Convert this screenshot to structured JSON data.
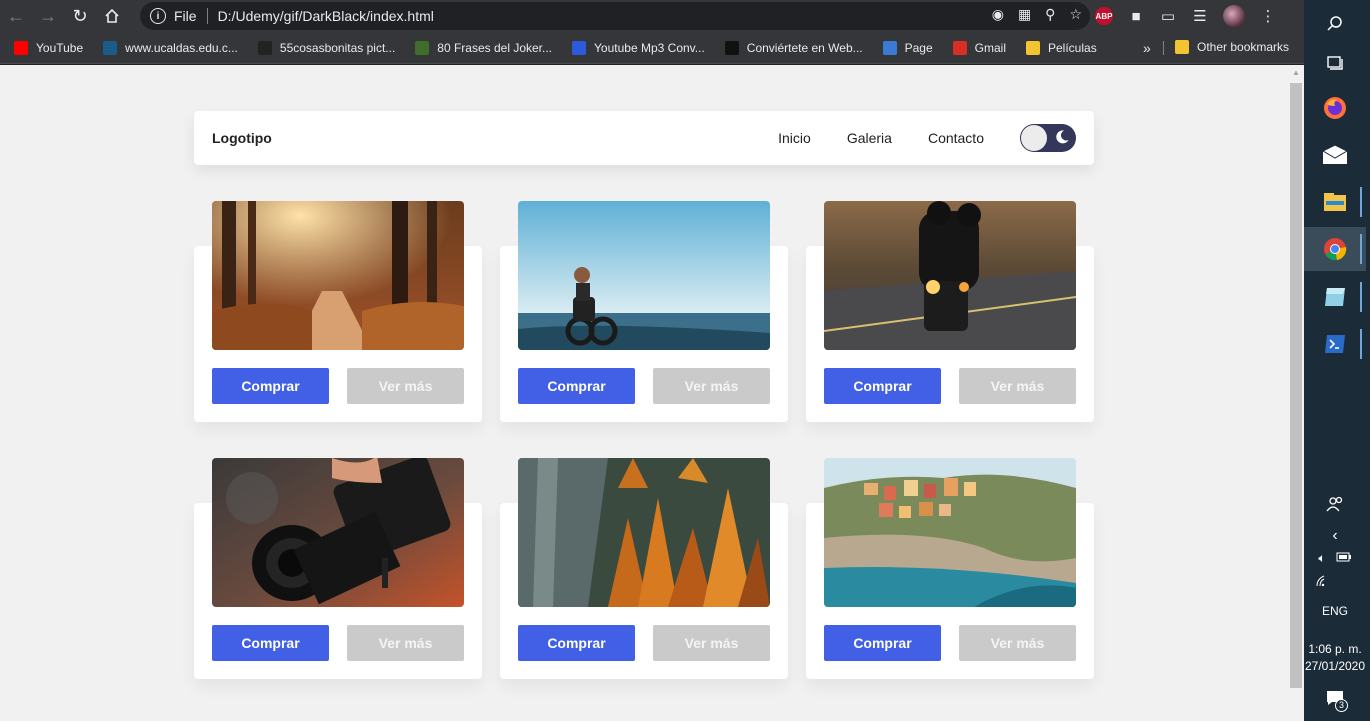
{
  "browser": {
    "address_label": "File",
    "url": "D:/Udemy/gif/DarkBlack/index.html",
    "bookmarks": [
      {
        "label": "YouTube",
        "color": "#ff0000"
      },
      {
        "label": "www.ucaldas.edu.c...",
        "color": "#1a5b8a"
      },
      {
        "label": "55cosasbonitas pict...",
        "color": "#222222"
      },
      {
        "label": "80 Frases del Joker...",
        "color": "#3f6d2b"
      },
      {
        "label": "Youtube Mp3 Conv...",
        "color": "#2d5ad8"
      },
      {
        "label": "Conviértete en Web...",
        "color": "#111111"
      },
      {
        "label": "Page",
        "color": "#3a7bd5"
      },
      {
        "label": "Gmail",
        "color": "#d93025"
      },
      {
        "label": "Películas",
        "color": "#f4c430"
      }
    ],
    "more_bookmarks": "»",
    "other_bookmarks": "Other bookmarks"
  },
  "site": {
    "logo": "Logotipo",
    "nav": [
      "Inicio",
      "Galeria",
      "Contacto"
    ],
    "dark_mode_on": true,
    "cards": [
      {
        "photo": "forest",
        "buy_label": "Comprar",
        "more_label": "Ver más"
      },
      {
        "photo": "beach-bike",
        "buy_label": "Comprar",
        "more_label": "Ver más"
      },
      {
        "photo": "motorcycle",
        "buy_label": "Comprar",
        "more_label": "Ver más"
      },
      {
        "photo": "camera",
        "buy_label": "Comprar",
        "more_label": "Ver más"
      },
      {
        "photo": "autumn-cliff",
        "buy_label": "Comprar",
        "more_label": "Ver más"
      },
      {
        "photo": "coastal-village",
        "buy_label": "Comprar",
        "more_label": "Ver más"
      }
    ]
  },
  "taskbar": {
    "language": "ENG",
    "time": "1:06 p. m.",
    "date": "27/01/2020",
    "notifications": "3"
  }
}
